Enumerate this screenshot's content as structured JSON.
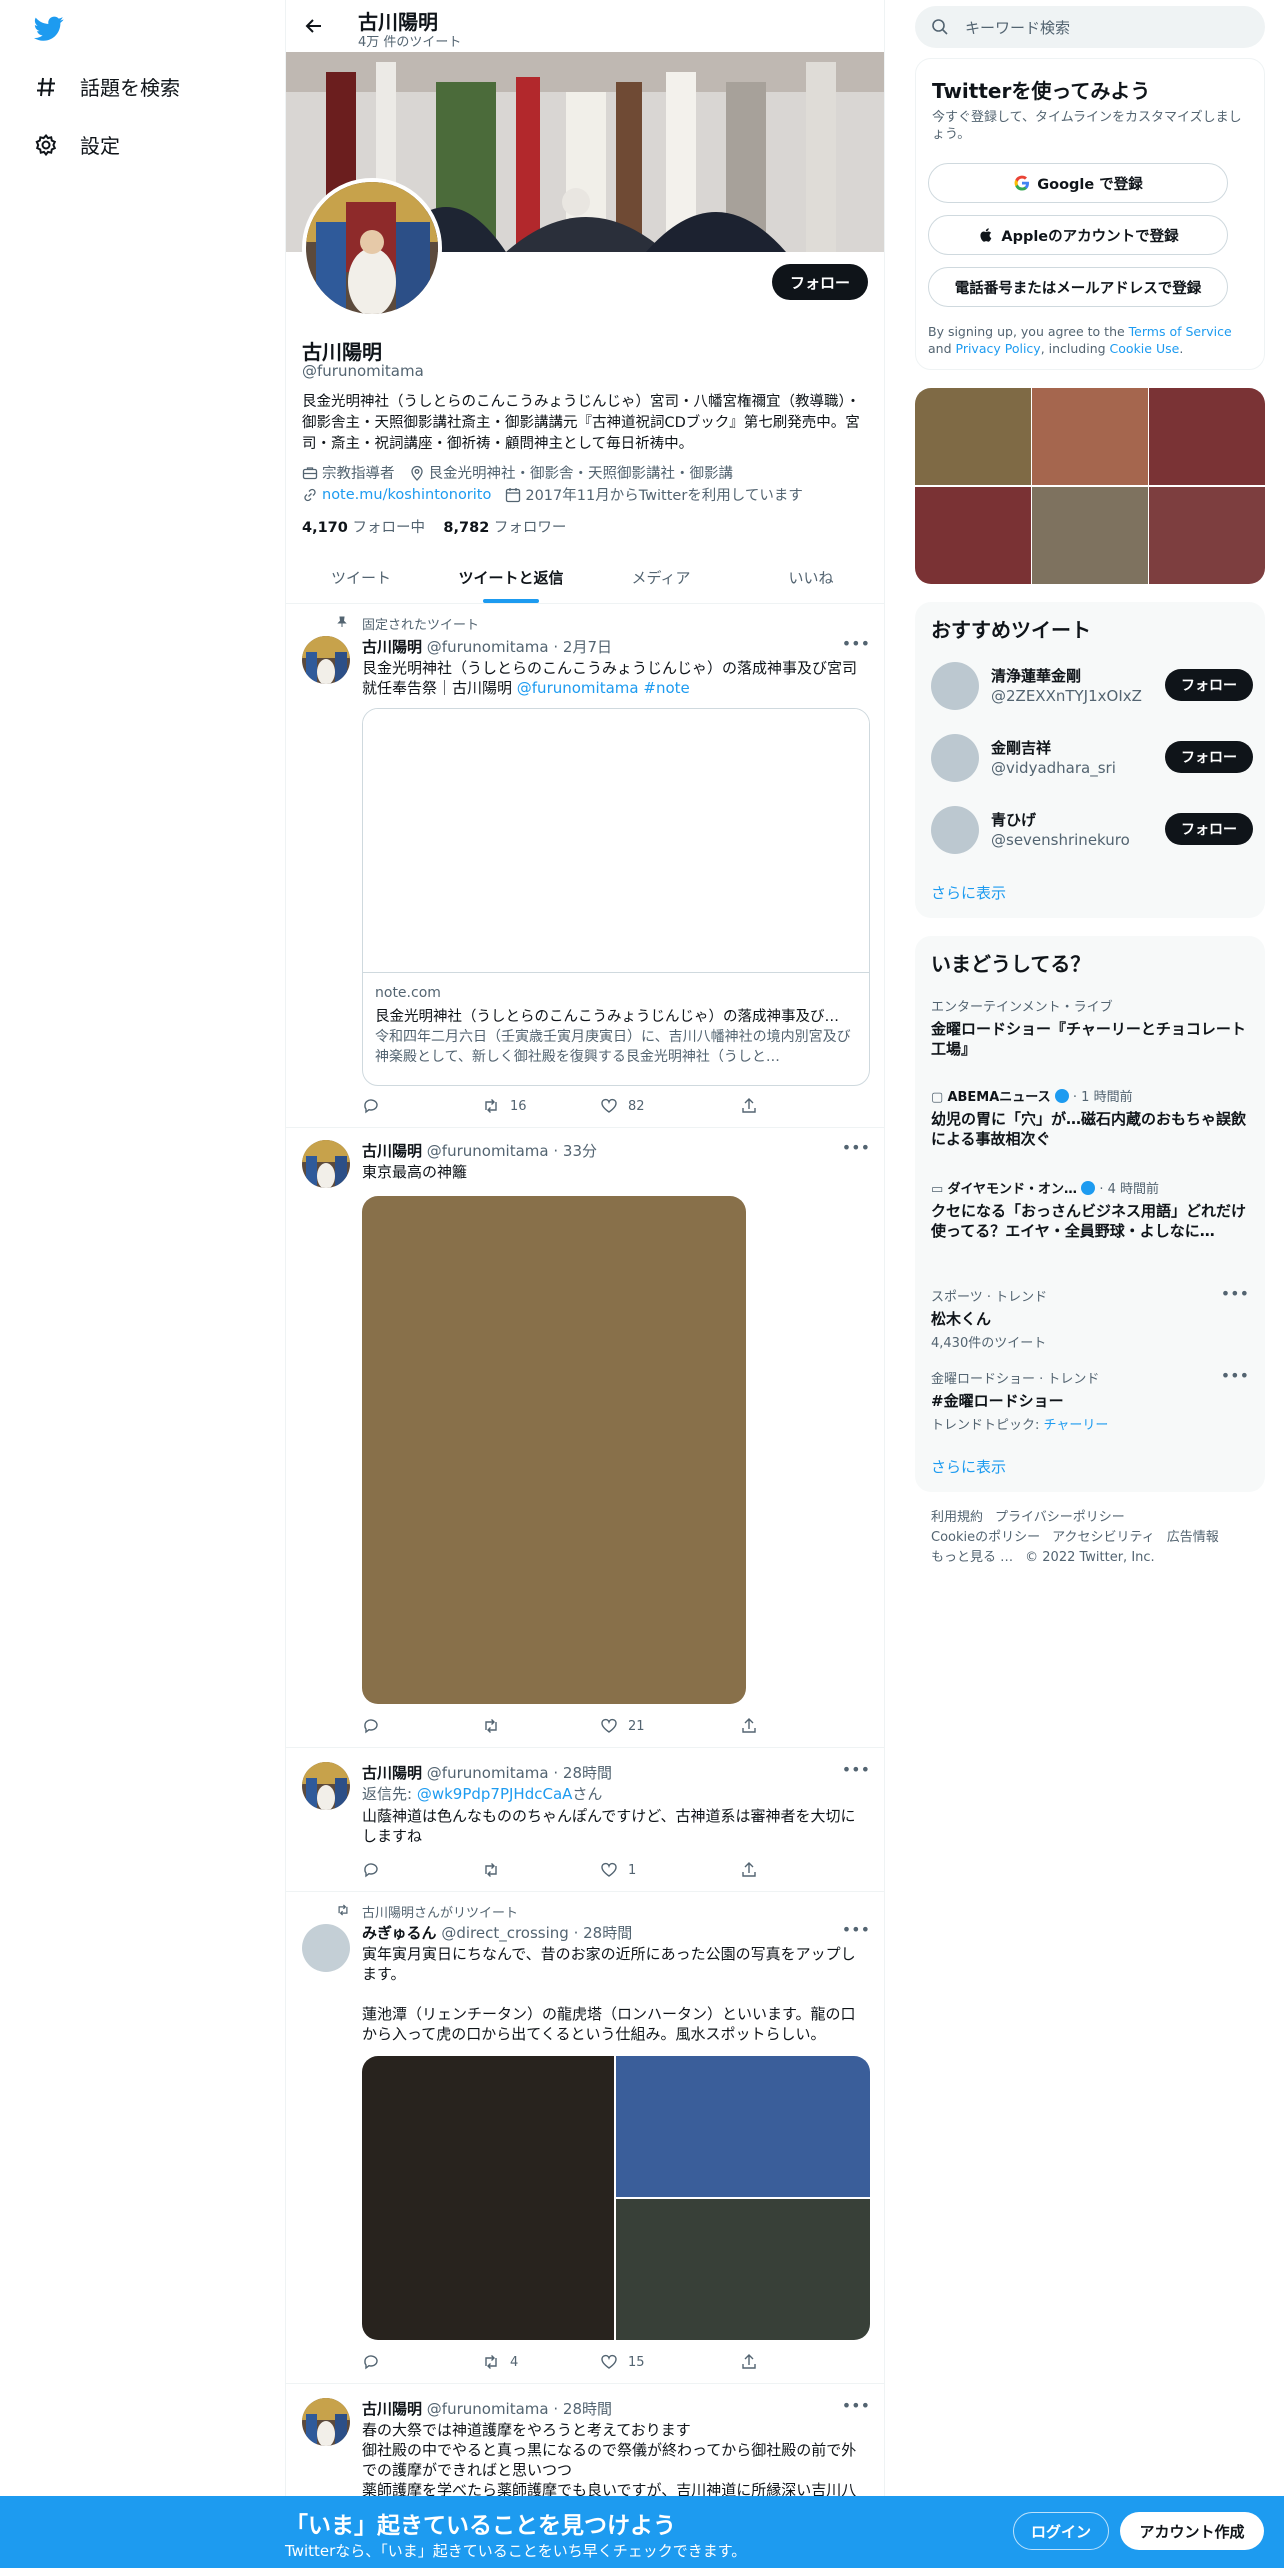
{
  "nav": {
    "explore_label": "話題を検索",
    "settings_label": "設定"
  },
  "profile": {
    "name": "古川陽明",
    "tweet_count": "4万 件のツイート",
    "handle": "@furunomitama",
    "follow_label": "フォロー",
    "bio": "艮金光明神社（うしとらのこんこうみょうじんじゃ）宮司・八幡宮権禰宜（教導職）・御影舎主・天照御影講社斎主・御影講講元『古神道祝詞CDブック』第七刷発売中。宮司・斎主・祝詞講座・御祈祷・顧問神主として毎日祈祷中。",
    "category": "宗教指導者",
    "location": "艮金光明神社・御影舎・天照御影講社・御影講",
    "url": "note.mu/koshintonorito",
    "joined": "2017年11月からTwitterを利用しています",
    "following_count": "4,170",
    "following_label": "フォロー中",
    "followers_count": "8,782",
    "followers_label": "フォロワー"
  },
  "tabs": [
    "ツイート",
    "ツイートと返信",
    "メディア",
    "いいね"
  ],
  "tweets": [
    {
      "social": "固定されたツイート",
      "name": "古川陽明",
      "meta": "@furunomitama · 2月7日",
      "text": "艮金光明神社（うしとらのこんこうみょうじんじゃ）の落成神事及び宮司就任奉告祭｜古川陽明 ",
      "mention": "@furunomitama",
      "hashtag": "#note",
      "card_domain": "note.com",
      "card_title": "艮金光明神社（うしとらのこんこうみょうじんじゃ）の落成神事及び…",
      "card_desc": "令和四年二月六日（壬寅歳壬寅月庚寅日）に、吉川八幡神社の境内別宮及び神楽殿として、新しく御社殿を復興する艮金光明神社（うしと…",
      "retweets": "16",
      "likes": "82"
    },
    {
      "name": "古川陽明",
      "meta": "@furunomitama · 33分",
      "text": "東京最高の神籬",
      "retweets": "",
      "likes": "21"
    },
    {
      "name": "古川陽明",
      "meta": "@furunomitama · 28時間",
      "reply_prefix": "返信先: ",
      "reply_handle": "@wk9Pdp7PJHdcCaA",
      "reply_suffix": "さん",
      "text": "山蔭神道は色んなもののちゃんぽんですけど、古神道系は審神者を大切にしますね",
      "retweets": "",
      "likes": "1"
    },
    {
      "social": "古川陽明さんがリツイート",
      "name": "みぎゅるん",
      "meta": "@direct_crossing · 28時間",
      "text": "寅年寅月寅日にちなんで、昔のお家の近所にあった公園の写真をアップします。\n\n蓮池潭（リェンチータン）の龍虎塔（ロンハータン）といいます。龍の口から入って虎の口から出てくるという仕組み。風水スポットらしい。",
      "retweets": "4",
      "likes": "15"
    },
    {
      "name": "古川陽明",
      "meta": "@furunomitama · 28時間",
      "text": "春の大祭では神道護摩をやろうと考えております\n御社殿の中でやると真っ黒になるので祭儀が終わってから御社殿の前で外での護摩ができればと思いつつ\n薬師護摩を学べたら薬師護摩でも良いですが、吉川神道に所縁深い吉川八"
    }
  ],
  "right": {
    "search_placeholder": "キーワード検索",
    "signup_title": "Twitterを使ってみよう",
    "signup_sub": "今すぐ登録して、タイムラインをカスタマイズしましょう。",
    "google_btn": "Google で登録",
    "apple_btn": "Appleのアカウントで登録",
    "phone_btn": "電話番号またはメールアドレスで登録",
    "note_1": "By signing up, you agree to the ",
    "terms": "Terms of Service",
    "note_2": " and ",
    "privacy": "Privacy Policy",
    "note_3": ", including ",
    "cookie": "Cookie Use",
    "note_4": ".",
    "who_title": "おすすめツイート",
    "who": [
      {
        "name": "清浄蓮華金剛",
        "handle": "@2ZEXXnTYJ1xOIxZ",
        "btn": "フォロー"
      },
      {
        "name": "金剛吉祥",
        "handle": "@vidyadhara_sri",
        "btn": "フォロー"
      },
      {
        "name": "青ひげ",
        "handle": "@sevenshrinekuro",
        "btn": "フォロー"
      }
    ],
    "show_more": "さらに表示",
    "trends_title": "いまどうしてる？",
    "trends": [
      {
        "context": "エンターテインメント・ライブ",
        "title": "金曜ロードショー『チャーリーとチョコレート工場』"
      },
      {
        "context": "ABEMAニュース",
        "time": "· 1 時間前",
        "title": "幼児の胃に「穴」が…磁石内蔵のおもちゃ誤飲による事故相次ぐ"
      },
      {
        "context": "ダイヤモンド・オン…",
        "time": "· 4 時間前",
        "title": "クセになる「おっさんビジネス用語」どれだけ使ってる？エイヤ・全員野球・よしなに…"
      },
      {
        "context": "スポーツ · トレンド",
        "title": "松木くん",
        "note": "4,430件のツイート"
      },
      {
        "context": "金曜ロードショー · トレンド",
        "title": "#金曜ロードショー",
        "note_prefix": "トレンドトピック: ",
        "note_link": "チャーリー"
      }
    ],
    "footer": [
      "利用規約",
      "プライバシーポリシー",
      "Cookieのポリシー",
      "アクセシビリティ",
      "広告情報",
      "もっと見る …",
      "© 2022 Twitter, Inc."
    ]
  },
  "bottom": {
    "title": "「いま」起きていることを見つけよう",
    "sub": "Twitterなら、「いま」起きていることをいち早くチェックできます。",
    "login": "ログイン",
    "signup": "アカウント作成"
  },
  "colors": {
    "accent": "#1d9bf0",
    "media_tile_brown": "#88704a",
    "grid": [
      "#7f6a45",
      "#a5664e",
      "#7a3335",
      "#7a3234",
      "#7e725f",
      "#7d3e3f"
    ]
  }
}
